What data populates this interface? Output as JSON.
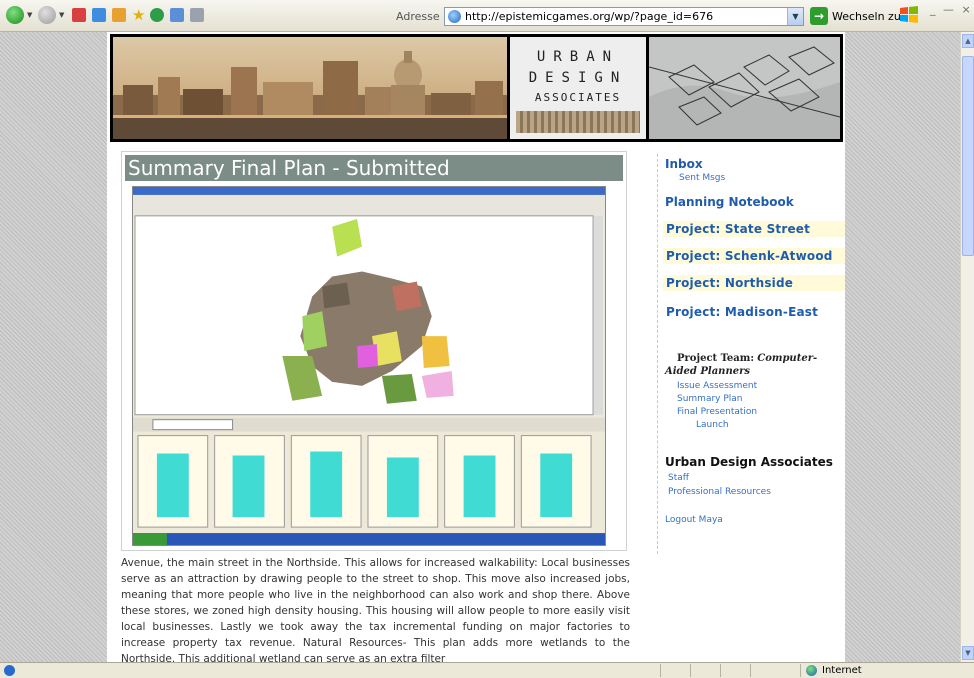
{
  "browser": {
    "address_label": "Adresse",
    "url": "http://epistemicgames.org/wp/?page_id=676",
    "go_label": "Wechseln zu",
    "window_controls": "_ — ×",
    "status_zone": "Internet"
  },
  "banner": {
    "logo_line1": "URBAN",
    "logo_line2": "DESIGN",
    "logo_line3": "ASSOCIATES"
  },
  "main": {
    "title": "Summary Final Plan - Submitted",
    "body_text": "Avenue, the main street in the Northside. This allows for increased walkability: Local businesses serve as an attraction by drawing people to the street to shop. This move also increased jobs, meaning that more people who live in the neighborhood can also work and shop there. Above these stores, we zoned high density housing. This housing will allow people to more easily visit local businesses. Lastly we took away the tax incremental funding on major factories to increase property tax revenue. Natural Resources- This plan adds more wetlands to the Northside. This additional wetland can serve as an extra filter"
  },
  "sidebar": {
    "inbox": "Inbox",
    "sent_msgs": "Sent Msgs",
    "planning_notebook": "Planning Notebook",
    "projects": [
      "Project: State Street",
      "Project: Schenk-Atwood",
      "Project: Northside",
      "Project: Madison-East"
    ],
    "team_label": "Project Team:",
    "team_name": "Computer-Aided Planners",
    "project_links": [
      "Issue Assessment",
      "Summary Plan",
      "Final Presentation"
    ],
    "launch": "Launch",
    "uda_heading": "Urban Design Associates",
    "staff": "Staff",
    "resources": "Professional Resources",
    "logout": "Logout Maya"
  },
  "colors": {
    "title_bar": "#7c8c86",
    "link": "#1f5cad",
    "project_highlight": "#fffbd8",
    "bar_fill": "#40dcd4"
  },
  "icons": [
    "back-icon",
    "forward-icon",
    "stop-icon",
    "refresh-icon",
    "home-icon",
    "favorites-icon",
    "history-icon",
    "mail-icon",
    "print-icon",
    "page-icon",
    "go-icon",
    "windows-logo-icon",
    "globe-icon"
  ]
}
